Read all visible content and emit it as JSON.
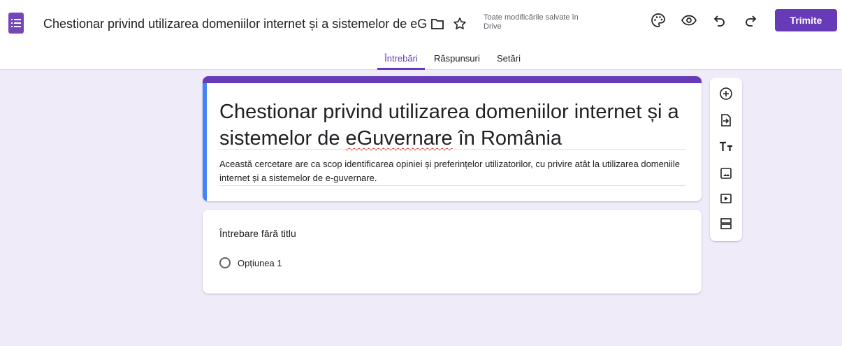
{
  "app": {
    "logo_icon": "forms-list-icon",
    "accent_color": "#673ab7",
    "doc_title": "Chestionar privind utilizarea domeniilor internet și a sistemelor de eGuvernare în România",
    "save_status": "Toate modificările salvate în Drive",
    "send_label": "Trimite"
  },
  "header_icons": [
    "folder-icon",
    "star-icon",
    "palette-icon",
    "eye-icon",
    "undo-icon",
    "redo-icon"
  ],
  "tabs": [
    {
      "label": "Întrebări",
      "active": true
    },
    {
      "label": "Răspunsuri",
      "active": false
    },
    {
      "label": "Setări",
      "active": false
    }
  ],
  "form": {
    "title_part1": "Chestionar privind utilizarea domeniilor internet și a sistemelor de ",
    "title_spell": "eGuvernare",
    "title_part2": " în România",
    "description": "Această cercetare are ca scop identificarea opiniei și preferințelor utilizatorilor, cu privire atât la utilizarea domeniile internet și a sistemelor de e-guvernare."
  },
  "question": {
    "title": "Întrebare fără titlu",
    "options": [
      "Opțiunea 1"
    ]
  },
  "toolbar": [
    "add-question-icon",
    "import-questions-icon",
    "add-title-icon",
    "add-image-icon",
    "add-video-icon",
    "add-section-icon"
  ]
}
